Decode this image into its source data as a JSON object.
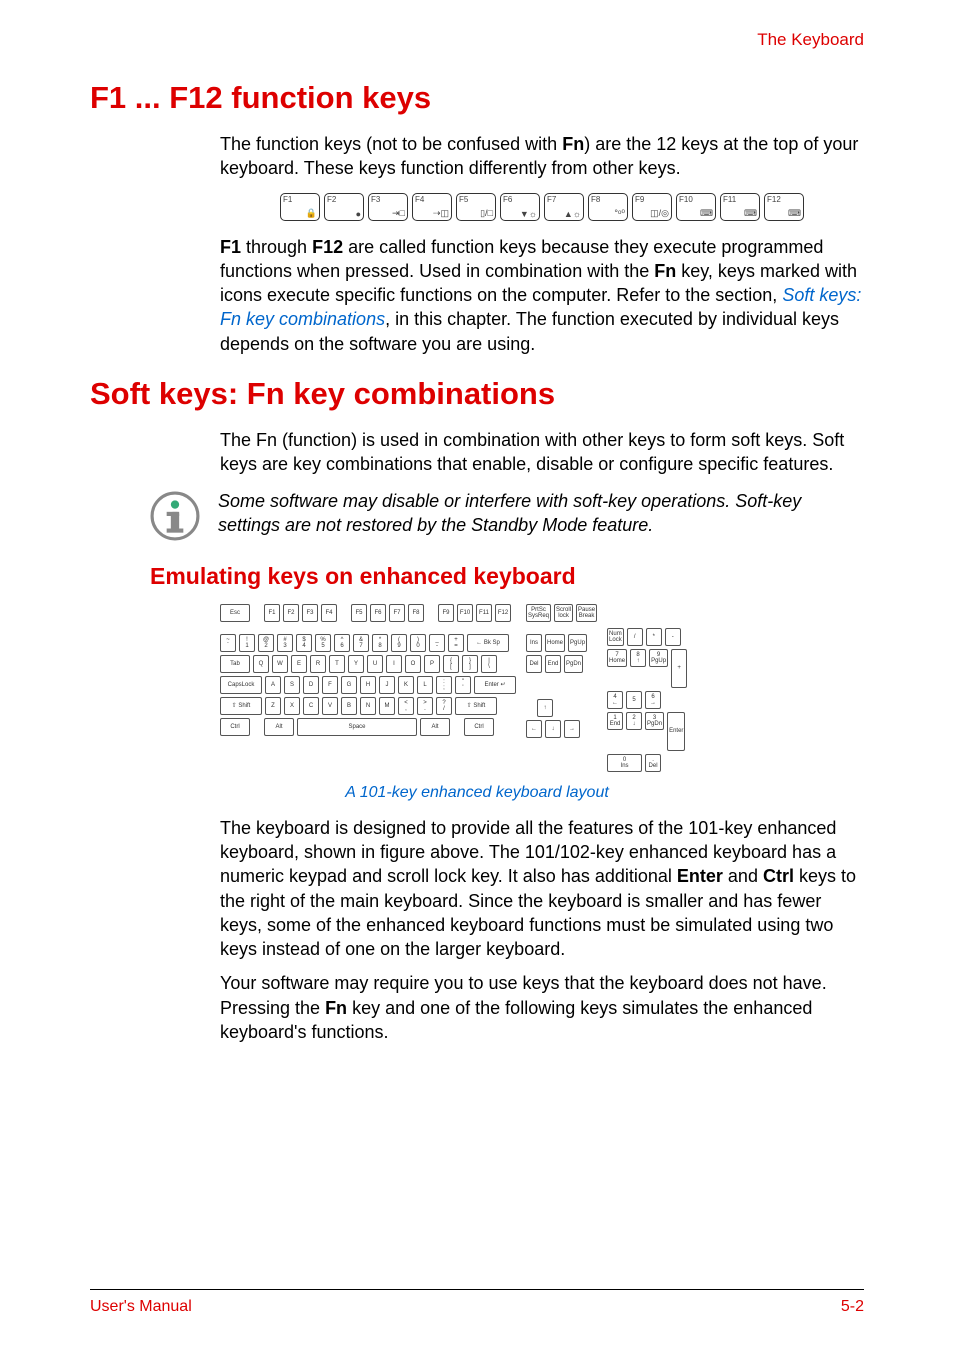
{
  "header": {
    "right": "The Keyboard"
  },
  "sections": {
    "s1": {
      "title": "F1 ... F12 function keys",
      "p1a": "The function keys (not to be confused with ",
      "p1b": "Fn",
      "p1c": ") are the 12 keys at the top of your keyboard. These keys function differently from other keys.",
      "p2a": "F1",
      "p2b": " through ",
      "p2c": "F12",
      "p2d": " are called function keys because they execute programmed functions when pressed. Used in combination with the ",
      "p2e": "Fn",
      "p2f": " key, keys marked with icons execute specific functions on the computer. Refer to the section, ",
      "p2link": "Soft keys: Fn key combinations",
      "p2g": ", in this chapter. The function executed by individual keys depends on the software you are using."
    },
    "s2": {
      "title": "Soft keys: Fn key combinations",
      "p1": "The Fn (function) is used in combination with other keys to form soft keys. Soft keys are key combinations that enable, disable or configure specific features.",
      "note": "Some software may disable or interfere with soft-key operations. Soft-key settings are not restored by the Standby Mode feature."
    },
    "s3": {
      "title": "Emulating keys on enhanced keyboard",
      "caption": "A 101-key enhanced keyboard layout",
      "p1a": "The keyboard is designed to provide all the features of the 101-key enhanced keyboard, shown in figure above. The 101/102-key enhanced keyboard has a numeric keypad and scroll lock key. It also has additional ",
      "p1b": "Enter",
      "p1c": " and ",
      "p1d": "Ctrl",
      "p1e": " keys to the right of the main keyboard. Since the keyboard is smaller and has fewer keys, some of the enhanced keyboard functions must be simulated using two keys instead of one on the larger keyboard.",
      "p2a": "Your software may require you to use keys that the keyboard does not have. Pressing the ",
      "p2b": "Fn",
      "p2c": " key and one of the following keys simulates the enhanced keyboard's functions."
    }
  },
  "fkeys": [
    {
      "label": "F1",
      "icon": "🔒"
    },
    {
      "label": "F2",
      "icon": "●"
    },
    {
      "label": "F3",
      "icon": "⇥□"
    },
    {
      "label": "F4",
      "icon": "⇢◫"
    },
    {
      "label": "F5",
      "icon": "▯/□"
    },
    {
      "label": "F6",
      "icon": "▼☼"
    },
    {
      "label": "F7",
      "icon": "▲☼"
    },
    {
      "label": "F8",
      "icon": "°ᵒ⁰"
    },
    {
      "label": "F9",
      "icon": "◫/◎"
    },
    {
      "label": "F10",
      "icon": "⌨"
    },
    {
      "label": "F11",
      "icon": "⌨"
    },
    {
      "label": "F12",
      "icon": "⌨"
    }
  ],
  "kbd": {
    "row0": [
      "Esc",
      "",
      "F1",
      "F2",
      "F3",
      "F4",
      "",
      "F5",
      "F6",
      "F7",
      "F8",
      "",
      "F9",
      "F10",
      "F11",
      "F12"
    ],
    "row1": [
      "~\n`",
      "!\n1",
      "@\n2",
      "#\n3",
      "$\n4",
      "%\n5",
      "^\n6",
      "&\n7",
      "*\n8",
      "(\n9",
      ")\n0",
      "_\n-",
      "+\n=",
      "← Bk Sp"
    ],
    "row2": [
      "Tab",
      "Q",
      "W",
      "E",
      "R",
      "T",
      "Y",
      "U",
      "I",
      "O",
      "P",
      "{\n[",
      "}\n]",
      "|\n\\"
    ],
    "row3": [
      "CapsLock",
      "A",
      "S",
      "D",
      "F",
      "G",
      "H",
      "J",
      "K",
      "L",
      ":\n;",
      "\"\n'",
      "Enter ↵"
    ],
    "row4": [
      "⇧ Shift",
      "Z",
      "X",
      "C",
      "V",
      "B",
      "N",
      "M",
      "<\n,",
      ">\n.",
      "?\n/",
      "⇧ Shift"
    ],
    "row5": [
      "Ctrl",
      "",
      "Alt",
      "Space",
      "Alt",
      "",
      "Ctrl"
    ],
    "nav0": [
      "PrtSc\nSysReq",
      "Scroll\nlock",
      "Pause\nBreak"
    ],
    "nav1": [
      "Ins",
      "Home",
      "PgUp"
    ],
    "nav2": [
      "Del",
      "End",
      "PgDn"
    ],
    "nav3": [
      "",
      "↑",
      ""
    ],
    "nav4": [
      "←",
      "↓",
      "→"
    ],
    "num0": [
      "Num\nLock",
      "/",
      "*",
      "-"
    ],
    "num1": [
      "7\nHome",
      "8\n↑",
      "9\nPgUp"
    ],
    "num2": [
      "4\n←",
      "5",
      "6\n→"
    ],
    "num3": [
      "1\nEnd",
      "2\n↓",
      "3\nPgDn"
    ],
    "num4": [
      "0\nIns",
      "",
      ".\nDel"
    ],
    "numPlus": "+",
    "numEnter": "Enter"
  },
  "footer": {
    "left": "User's Manual",
    "right": "5-2"
  }
}
